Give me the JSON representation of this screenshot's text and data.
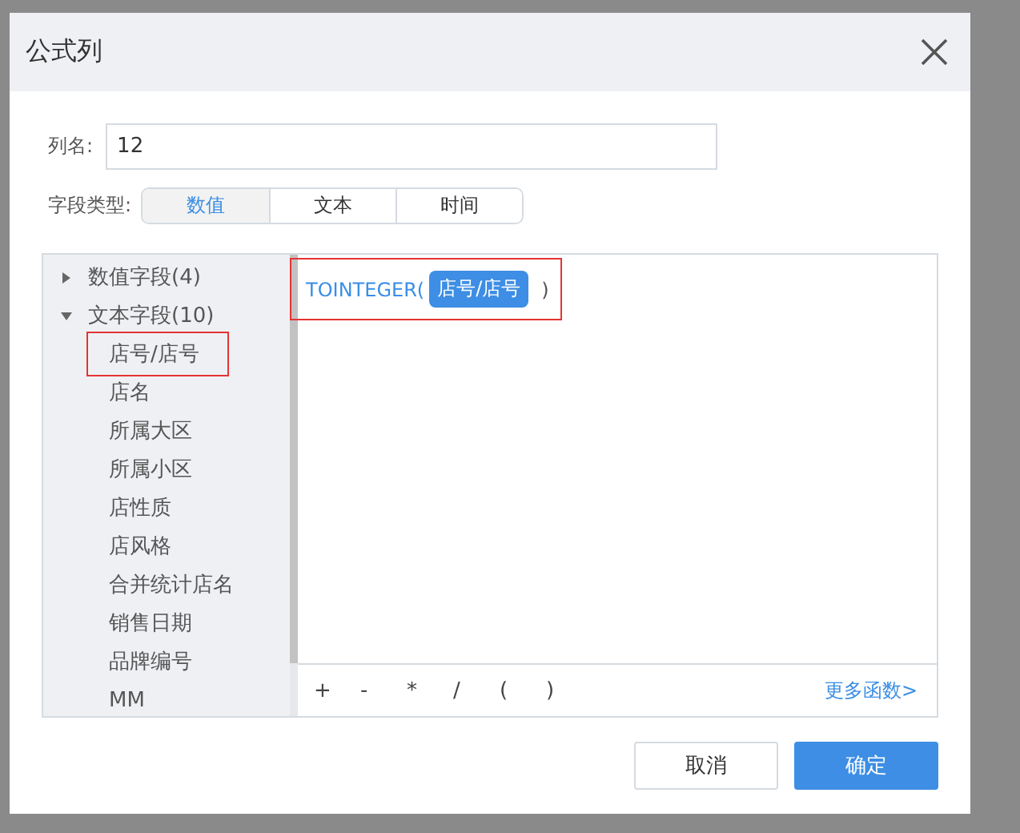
{
  "dialog": {
    "title": "公式列"
  },
  "column_name": {
    "label": "列名:",
    "value": "12"
  },
  "field_type": {
    "label": "字段类型:",
    "options": [
      {
        "label": "数值",
        "selected": true
      },
      {
        "label": "文本",
        "selected": false
      },
      {
        "label": "时间",
        "selected": false
      }
    ]
  },
  "field_tree": [
    {
      "label": "数值字段(4)",
      "expanded": false
    },
    {
      "label": "文本字段(10)",
      "expanded": true,
      "children": [
        {
          "label": "店号/店号",
          "annotated": true
        },
        {
          "label": "店名",
          "annotated": false
        },
        {
          "label": "所属大区",
          "annotated": false
        },
        {
          "label": "所属小区",
          "annotated": false
        },
        {
          "label": "店性质",
          "annotated": false
        },
        {
          "label": "店风格",
          "annotated": false
        },
        {
          "label": "合并统计店名",
          "annotated": false
        },
        {
          "label": "销售日期",
          "annotated": false
        },
        {
          "label": "品牌编号",
          "annotated": false
        },
        {
          "label": "MM",
          "annotated": false
        }
      ]
    }
  ],
  "formula": {
    "function": "TOINTEGER(",
    "field": "店号/店号",
    "closing": ")",
    "annotated": true
  },
  "operators": [
    "+",
    "-",
    "*",
    "/",
    "(",
    ")"
  ],
  "more_functions": "更多函数>",
  "buttons": [
    {
      "label": "取消",
      "kind": "secondary"
    },
    {
      "label": "确定",
      "kind": "primary"
    }
  ]
}
